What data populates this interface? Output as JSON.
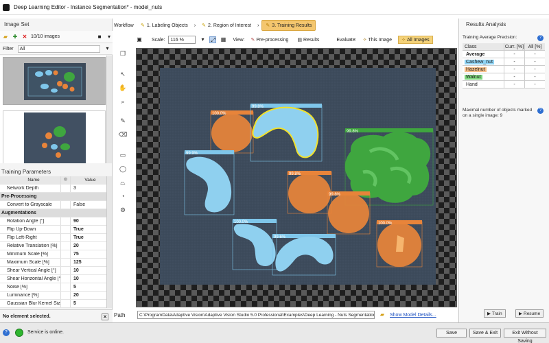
{
  "window": {
    "title": "Deep Learning Editor - Instance Segmentation* - model_nuts"
  },
  "image_set": {
    "title": "Image Set",
    "count_label": "10/10 images",
    "filter_label": "Filter",
    "filter_value": "All"
  },
  "training_params": {
    "title": "Training Parameters",
    "col_name": "Name",
    "col_value": "Value",
    "rows": [
      {
        "name": "Network Depth",
        "value": "3",
        "group": false,
        "bold": false
      },
      {
        "name": "Pre-Processing",
        "value": "",
        "group": true,
        "bold": false
      },
      {
        "name": "Convert to Grayscale",
        "value": "False",
        "group": false,
        "bold": false
      },
      {
        "name": "Augmentations",
        "value": "",
        "group": true,
        "bold": false
      },
      {
        "name": "Rotation Angle [°]",
        "value": "90",
        "group": false,
        "bold": true
      },
      {
        "name": "Flip Up-Down",
        "value": "True",
        "group": false,
        "bold": true
      },
      {
        "name": "Flip Left-Right",
        "value": "True",
        "group": false,
        "bold": true
      },
      {
        "name": "Relative Translation [%]",
        "value": "20",
        "group": false,
        "bold": true
      },
      {
        "name": "Minimum Scale [%]",
        "value": "75",
        "group": false,
        "bold": true
      },
      {
        "name": "Maximum Scale [%]",
        "value": "125",
        "group": false,
        "bold": true
      },
      {
        "name": "Shear Vertical Angle [°]",
        "value": "10",
        "group": false,
        "bold": true
      },
      {
        "name": "Shear Horizontal Angle [°]",
        "value": "10",
        "group": false,
        "bold": true
      },
      {
        "name": "Noise [%]",
        "value": "5",
        "group": false,
        "bold": true
      },
      {
        "name": "Luminance [%]",
        "value": "20",
        "group": false,
        "bold": true
      },
      {
        "name": "Gaussian Blur Kernel Size [...]",
        "value": "5",
        "group": false,
        "bold": true
      }
    ],
    "no_element": "No element selected."
  },
  "workflow": {
    "label": "Workflow",
    "steps": [
      {
        "label": "1. Labeling Objects",
        "active": false
      },
      {
        "label": "2. Region of Interest",
        "active": false
      },
      {
        "label": "3. Training Results",
        "active": true
      }
    ]
  },
  "view_toolbar": {
    "scale_label": "Scale:",
    "scale_value": "116 %",
    "view_label": "View:",
    "preprocessing": "Pre-processing",
    "results": "Results",
    "evaluate_label": "Evaluate:",
    "this_image": "This Image",
    "all_images": "All Images"
  },
  "viewer": {
    "detections": [
      {
        "label": "100.0%",
        "kind": "hazelnut"
      },
      {
        "label": "99.8%",
        "kind": "cashew"
      },
      {
        "label": "99.9%",
        "kind": "cashew"
      },
      {
        "label": "99.8%",
        "kind": "walnut"
      },
      {
        "label": "99.8%",
        "kind": "hazelnut"
      },
      {
        "label": "99.8%",
        "kind": "hazelnut"
      },
      {
        "label": "100.0%",
        "kind": "cashew"
      },
      {
        "label": "99.6%",
        "kind": "cashew"
      },
      {
        "label": "100.0%",
        "kind": "hazelnut"
      }
    ]
  },
  "path": {
    "label": "Path",
    "value": "C:\\ProgramData\\Adaptive Vision\\Adaptive Vision Studio 5.0 Professional\\Examples\\Deep Learning - Nuts Segmentation",
    "show_details": "Show Model Details..."
  },
  "results_analysis": {
    "title": "Results Analysis",
    "precision_label": "Training Average Precision:",
    "col_class": "Class",
    "col_curr": "Curr. [%]",
    "col_all": "All [%]",
    "rows": [
      {
        "name": "Average",
        "curr": "-",
        "all": "-",
        "color": "#ffffff",
        "bold": true
      },
      {
        "name": "Cashew_nut",
        "curr": "-",
        "all": "-",
        "color": "#8fd3f4",
        "bold": false
      },
      {
        "name": "Hazelnut",
        "curr": "-",
        "all": "-",
        "color": "#f7c08a",
        "bold": false
      },
      {
        "name": "Walnut",
        "curr": "-",
        "all": "-",
        "color": "#7ed67e",
        "bold": false
      },
      {
        "name": "Hand",
        "curr": "-",
        "all": "-",
        "color": "#ffffff",
        "bold": false
      }
    ],
    "max_objects": "Maximal number of objects marked on a single image: 9",
    "train": "Train",
    "resume": "Resume"
  },
  "status": {
    "text": "Service is online.",
    "save": "Save",
    "save_exit": "Save & Exit",
    "exit_without_saving": "Exit Without Saving"
  },
  "colors": {
    "cashew": "#7fc6ea",
    "hazelnut": "#e8843a",
    "walnut": "#3fa63f",
    "active_step": "#f4c66e"
  }
}
